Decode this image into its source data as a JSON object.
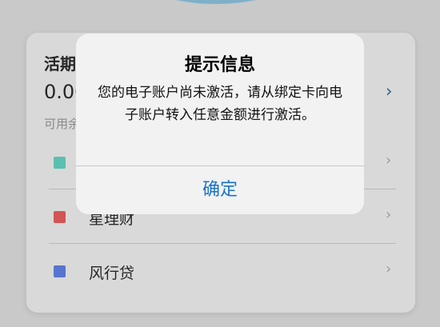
{
  "account_card": {
    "title": "活期",
    "balance": "0.00",
    "available_label": "可用余",
    "balance_chevron_icon": "chevron-right-icon"
  },
  "products": [
    {
      "name": "",
      "color": "#5bbfb0",
      "chevron_icon": "chevron-right-icon"
    },
    {
      "name": "星理财",
      "color": "#d35454",
      "chevron_icon": "chevron-right-icon"
    },
    {
      "name": "风行贷",
      "color": "#5874cf",
      "chevron_icon": "chevron-right-icon"
    }
  ],
  "dialog": {
    "title": "提示信息",
    "message": "您的电子账户尚未激活，请从绑定卡向电子账户转入任意金额进行激活。",
    "confirm_label": "确定"
  },
  "colors": {
    "accent": "#1a73c9",
    "header_arc": "#7fb0c9"
  }
}
